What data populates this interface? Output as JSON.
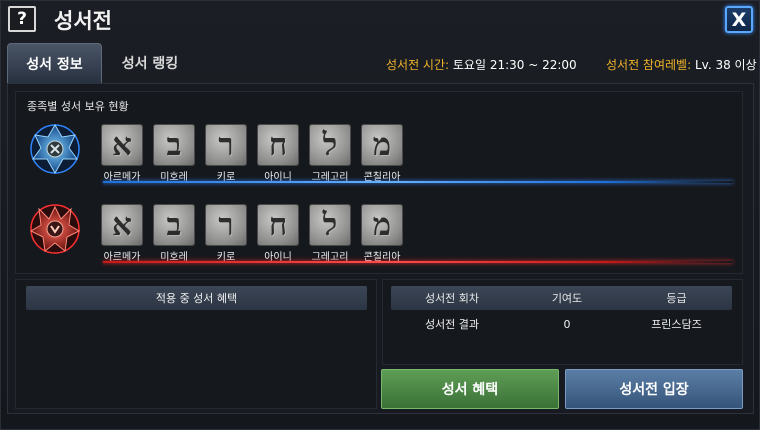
{
  "window": {
    "title": "성서전",
    "help_label": "?",
    "close_label": "X"
  },
  "tabs": [
    {
      "label": "성서 정보",
      "active": true
    },
    {
      "label": "성서 랭킹",
      "active": false
    }
  ],
  "info": {
    "time_label": "성서전 시간:",
    "time_value": "토요일 21:30 ~ 22:00",
    "level_label": "성서전 참여레벨:",
    "level_value": "Lv. 38 이상"
  },
  "holdings": {
    "title": "종족별 성서 보유 현황",
    "factions": [
      {
        "icon": "light-faction-emblem-icon",
        "accent": "#3a8cff",
        "books": [
          {
            "glyph": "א",
            "name": "아르메가"
          },
          {
            "glyph": "ב",
            "name": "미호레"
          },
          {
            "glyph": "ר",
            "name": "키로"
          },
          {
            "glyph": "ח",
            "name": "아이니"
          },
          {
            "glyph": "ל",
            "name": "그레고리"
          },
          {
            "glyph": "מ",
            "name": "콘칠리아"
          }
        ]
      },
      {
        "icon": "dark-faction-emblem-icon",
        "accent": "#ff3030",
        "books": [
          {
            "glyph": "א",
            "name": "아르메가"
          },
          {
            "glyph": "ב",
            "name": "미호레"
          },
          {
            "glyph": "ר",
            "name": "키로"
          },
          {
            "glyph": "ח",
            "name": "아이니"
          },
          {
            "glyph": "ל",
            "name": "그레고리"
          },
          {
            "glyph": "מ",
            "name": "콘칠리아"
          }
        ]
      }
    ]
  },
  "benefits": {
    "header": "적용 중 성서 혜택"
  },
  "results": {
    "headers": [
      "성서전 회차",
      "기여도",
      "등급"
    ],
    "row": [
      "성서전 결과",
      "0",
      "프린스담즈"
    ]
  },
  "buttons": {
    "benefit": "성서 혜택",
    "enter": "성서전 입장"
  }
}
